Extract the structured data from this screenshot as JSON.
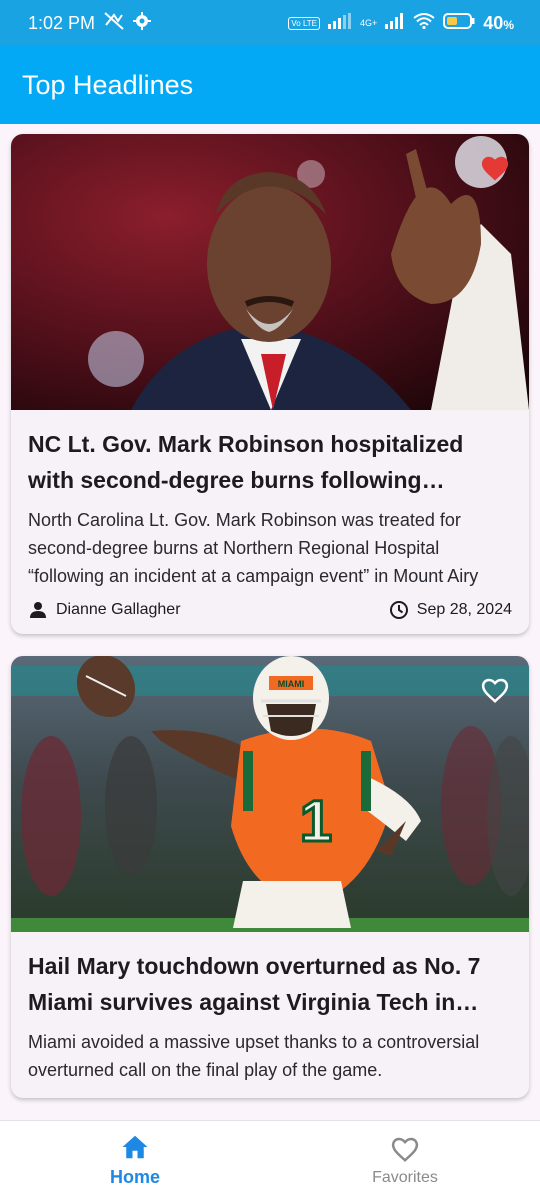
{
  "status_bar": {
    "time": "1:02 PM",
    "battery": "40",
    "battery_unit": "%",
    "network_label": "4G+",
    "volte_label": "Vo LTE"
  },
  "app_bar": {
    "title": "Top Headlines"
  },
  "articles": [
    {
      "title": "NC Lt. Gov. Mark Robinson hospitalized with second-degree burns following incident at a campaign event",
      "description": "North Carolina Lt. Gov. Mark Robinson was treated for second-degree burns at Northern Regional Hospital “following an incident at a campaign event” in Mount Airy",
      "author": "Dianne Gallagher",
      "date": "Sep 28, 2024",
      "favorited": true,
      "favorite_color": "#e53935"
    },
    {
      "title": "Hail Mary touchdown overturned as No. 7 Miami survives against Virginia Tech in thriller",
      "description": "Miami avoided a massive upset thanks to a controversial overturned call on the final play of the game.",
      "favorited": false,
      "jersey_number": "1",
      "helmet_text": "MIAMI"
    }
  ],
  "bottom_nav": {
    "home_label": "Home",
    "favorites_label": "Favorites",
    "active_color": "#1e88e5"
  }
}
